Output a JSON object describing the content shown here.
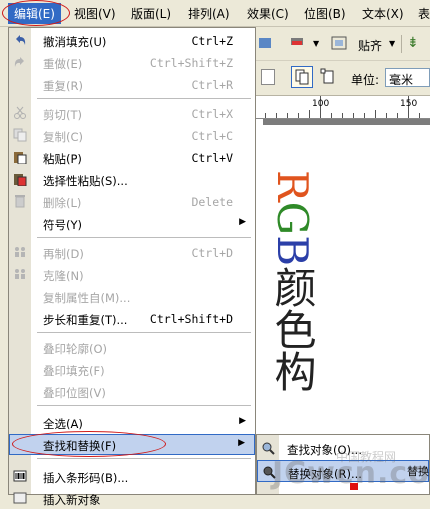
{
  "menubar": {
    "items": [
      "编辑(E)",
      "视图(V)",
      "版面(L)",
      "排列(A)",
      "效果(C)",
      "位图(B)",
      "文本(X)",
      "表"
    ],
    "active": "编辑(E)"
  },
  "toolbar": {
    "snap_label": "贴齐",
    "unit_label": "单位:",
    "unit_value": "毫米"
  },
  "ruler": {
    "labels": [
      "100",
      "150"
    ]
  },
  "canvas": {
    "letters": [
      "R",
      "G",
      "B",
      "颜",
      "色",
      "构"
    ],
    "colors": {
      "r": "#e0541e",
      "g": "#2f8a28",
      "b": "#2b3fa8",
      "k": "#222222"
    }
  },
  "edit_menu": {
    "items": [
      {
        "label": "撤消填充(U)",
        "shortcut": "Ctrl+Z",
        "enabled": true,
        "icon": "undo-icon"
      },
      {
        "label": "重做(E)",
        "shortcut": "Ctrl+Shift+Z",
        "enabled": false,
        "icon": "redo-icon"
      },
      {
        "label": "重复(R)",
        "shortcut": "Ctrl+R",
        "enabled": false,
        "icon": ""
      },
      {
        "label": "剪切(T)",
        "shortcut": "Ctrl+X",
        "enabled": false,
        "icon": "scissors-icon"
      },
      {
        "label": "复制(C)",
        "shortcut": "Ctrl+C",
        "enabled": false,
        "icon": "copy-icon"
      },
      {
        "label": "粘贴(P)",
        "shortcut": "Ctrl+V",
        "enabled": true,
        "icon": "paste-icon"
      },
      {
        "label": "选择性粘贴(S)...",
        "shortcut": "",
        "enabled": true,
        "icon": "paste-special-icon"
      },
      {
        "label": "删除(L)",
        "shortcut": "Delete",
        "enabled": false,
        "icon": "trash-icon"
      },
      {
        "label": "符号(Y)",
        "shortcut": "",
        "enabled": true,
        "icon": "",
        "submenu": true
      },
      {
        "label": "再制(D)",
        "shortcut": "Ctrl+D",
        "enabled": false,
        "icon": "duplicate-icon"
      },
      {
        "label": "克隆(N)",
        "shortcut": "",
        "enabled": false,
        "icon": "clone-icon"
      },
      {
        "label": "复制属性自(M)...",
        "shortcut": "",
        "enabled": false,
        "icon": ""
      },
      {
        "label": "步长和重复(T)...",
        "shortcut": "Ctrl+Shift+D",
        "enabled": true,
        "icon": ""
      },
      {
        "label": "叠印轮廓(O)",
        "shortcut": "",
        "enabled": false,
        "icon": ""
      },
      {
        "label": "叠印填充(F)",
        "shortcut": "",
        "enabled": false,
        "icon": ""
      },
      {
        "label": "叠印位图(V)",
        "shortcut": "",
        "enabled": false,
        "icon": ""
      },
      {
        "label": "全选(A)",
        "shortcut": "",
        "enabled": true,
        "icon": "",
        "submenu": true
      },
      {
        "label": "查找和替换(F)",
        "shortcut": "",
        "enabled": true,
        "icon": "",
        "submenu": true,
        "highlighted": true
      },
      {
        "label": "插入条形码(B)...",
        "shortcut": "",
        "enabled": true,
        "icon": "barcode-icon"
      },
      {
        "label": "插入新对象",
        "shortcut": "",
        "enabled": true,
        "icon": "new-object-icon"
      }
    ]
  },
  "find_submenu": {
    "items": [
      {
        "label": "查找对象(O)...",
        "icon": "find-object-icon"
      },
      {
        "label": "替换对象(R)...",
        "icon": "replace-object-icon",
        "highlighted": true
      }
    ],
    "side_label": "替换"
  },
  "watermark": {
    "main": "JCwcn.com",
    "sub": "中国教程网"
  }
}
